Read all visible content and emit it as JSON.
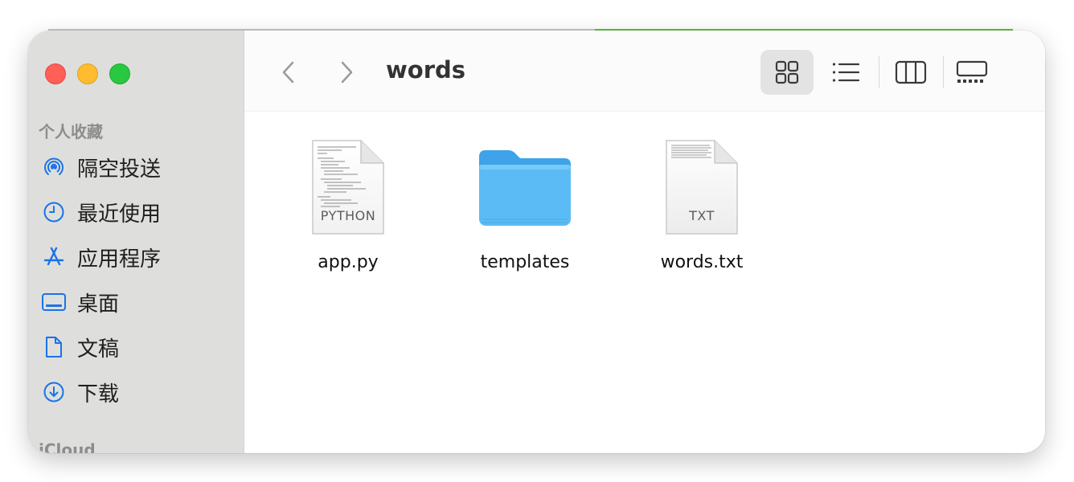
{
  "window": {
    "title": "words"
  },
  "sidebar": {
    "section_favorites": "个人收藏",
    "items": [
      {
        "label": "隔空投送",
        "icon": "airdrop-icon"
      },
      {
        "label": "最近使用",
        "icon": "clock-icon"
      },
      {
        "label": "应用程序",
        "icon": "applications-icon"
      },
      {
        "label": "桌面",
        "icon": "desktop-icon"
      },
      {
        "label": "文稿",
        "icon": "document-icon"
      },
      {
        "label": "下载",
        "icon": "download-icon"
      }
    ],
    "section_icloud": "iCloud"
  },
  "toolbar": {
    "views": [
      "icon-view",
      "list-view",
      "column-view",
      "gallery-view"
    ],
    "active_view": "icon-view"
  },
  "files": [
    {
      "name": "app.py",
      "kind": "python-file",
      "tag": "PYTHON"
    },
    {
      "name": "templates",
      "kind": "folder"
    },
    {
      "name": "words.txt",
      "kind": "text-file",
      "tag": "TXT"
    }
  ],
  "colors": {
    "accent": "#1a73e8",
    "folder": "#5bbcf5",
    "sidebar_bg": "#dedfdc"
  }
}
